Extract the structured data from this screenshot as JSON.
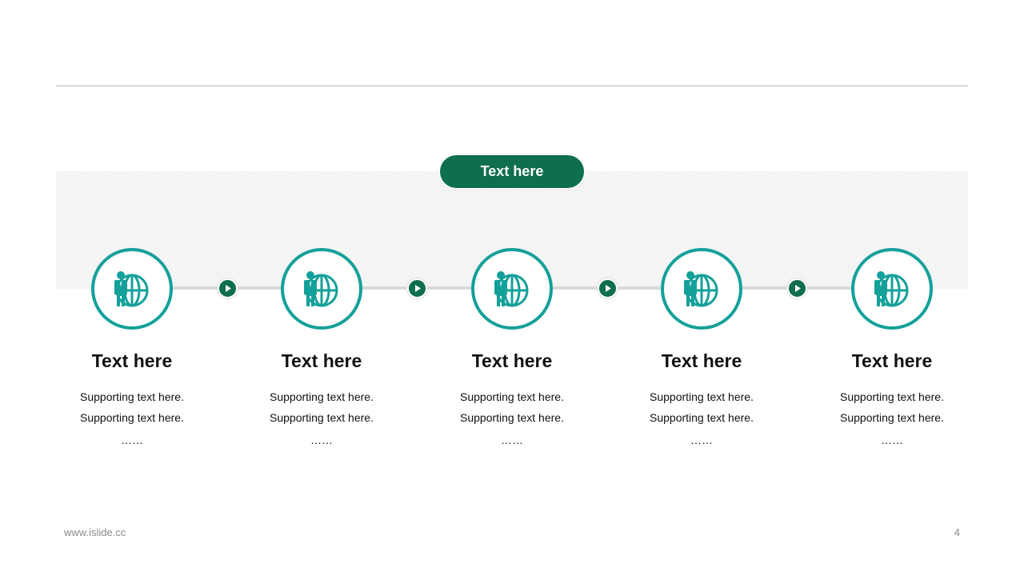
{
  "header": {
    "badge_label": "Text here"
  },
  "steps": [
    {
      "title": "Text here",
      "line1": "Supporting text here.",
      "line2": "Supporting text here.",
      "ellipsis": "……",
      "icon": "businessman-globe-icon"
    },
    {
      "title": "Text here",
      "line1": "Supporting text here.",
      "line2": "Supporting text here.",
      "ellipsis": "……",
      "icon": "businessman-globe-icon"
    },
    {
      "title": "Text here",
      "line1": "Supporting text here.",
      "line2": "Supporting text here.",
      "ellipsis": "……",
      "icon": "businessman-globe-icon"
    },
    {
      "title": "Text here",
      "line1": "Supporting text here.",
      "line2": "Supporting text here.",
      "ellipsis": "……",
      "icon": "businessman-globe-icon"
    },
    {
      "title": "Text here",
      "line1": "Supporting text here.",
      "line2": "Supporting text here.",
      "ellipsis": "……",
      "icon": "businessman-globe-icon"
    }
  ],
  "connector_icon": "play-arrow-icon",
  "footer": {
    "url": "www.islide.cc",
    "page": "4"
  },
  "colors": {
    "accent_teal": "#14a09a",
    "accent_green": "#0e6e4d",
    "connector_gray": "#d9d9d9",
    "rule_gray": "#b5b5b5"
  }
}
